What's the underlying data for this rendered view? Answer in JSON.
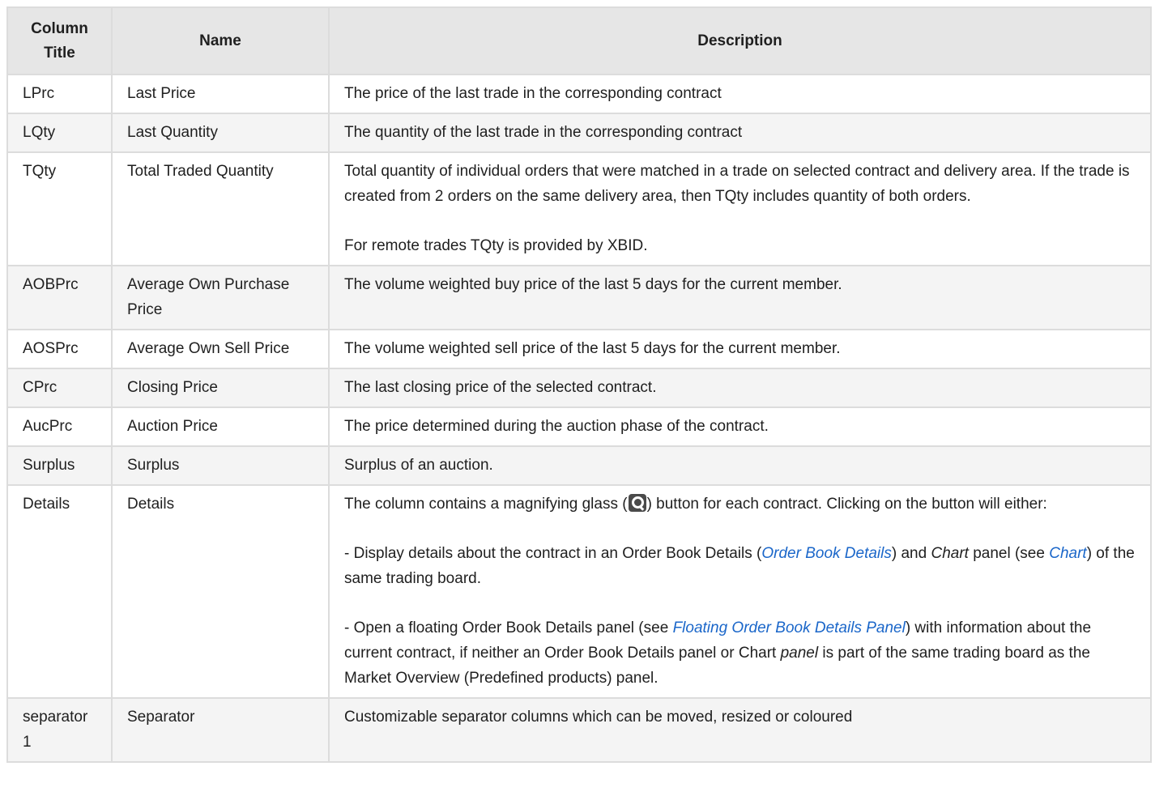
{
  "headers": {
    "column_title": "Column Title",
    "name": "Name",
    "description": "Description"
  },
  "rows": [
    {
      "column_title": "LPrc",
      "name": "Last Price",
      "description": "The price of the last trade in the corresponding contract"
    },
    {
      "column_title": "LQty",
      "name": "Last Quantity",
      "description": "The quantity of the last trade in the corresponding contract"
    },
    {
      "column_title": "TQty",
      "name": "Total Traded Quantity",
      "description": "Total quantity of individual orders that were matched in a trade on selected contract and delivery area. If the trade is created from 2 orders on the same delivery area, then TQty includes quantity of both orders.",
      "description_2": "For remote trades TQty is provided by XBID."
    },
    {
      "column_title": "AOBPrc",
      "name": "Average Own Purchase Price",
      "description": "The volume weighted buy price of the last 5 days for the current member."
    },
    {
      "column_title": "AOSPrc",
      "name": "Average Own Sell Price",
      "description": "The volume weighted sell price of the last 5 days for the current member."
    },
    {
      "column_title": "CPrc",
      "name": "Closing Price",
      "description": "The last closing price of the selected contract."
    },
    {
      "column_title": "AucPrc",
      "name": "Auction Price",
      "description": "The price determined during the auction phase of the contract."
    },
    {
      "column_title": "Surplus",
      "name": "Surplus",
      "description": "Surplus of an auction."
    },
    {
      "column_title": "Details",
      "name": "Details",
      "p1_before": "The column contains a magnifying glass (",
      "p1_icon": "magnifying-glass-icon",
      "p1_after": ") button for each contract. Clicking on the button will either:",
      "p2_before": "- Display details about the contract in an Order Book Details (",
      "p2_link1": "Order Book Details",
      "p2_mid1": ") and ",
      "p2_em": "Chart",
      "p2_mid2": " panel (see ",
      "p2_link2": "Chart",
      "p2_after": ") of the same trading board.",
      "p3_before": "- Open a floating Order Book Details panel (see ",
      "p3_link": "Floating Order Book Details Panel",
      "p3_mid": ") with information about the current contract, if neither an Order Book Details panel or Chart ",
      "p3_em": "panel",
      "p3_after": " is part of the same trading board as the Market Overview (Predefined products) panel."
    },
    {
      "column_title": "separator 1",
      "name": "Separator",
      "description": "Customizable separator columns which can be moved, resized or coloured"
    }
  ],
  "colors": {
    "link": "#1a66c9",
    "header_bg": "#e6e6e6",
    "stripe_bg": "#f4f4f4",
    "border": "#dcdcdc"
  }
}
